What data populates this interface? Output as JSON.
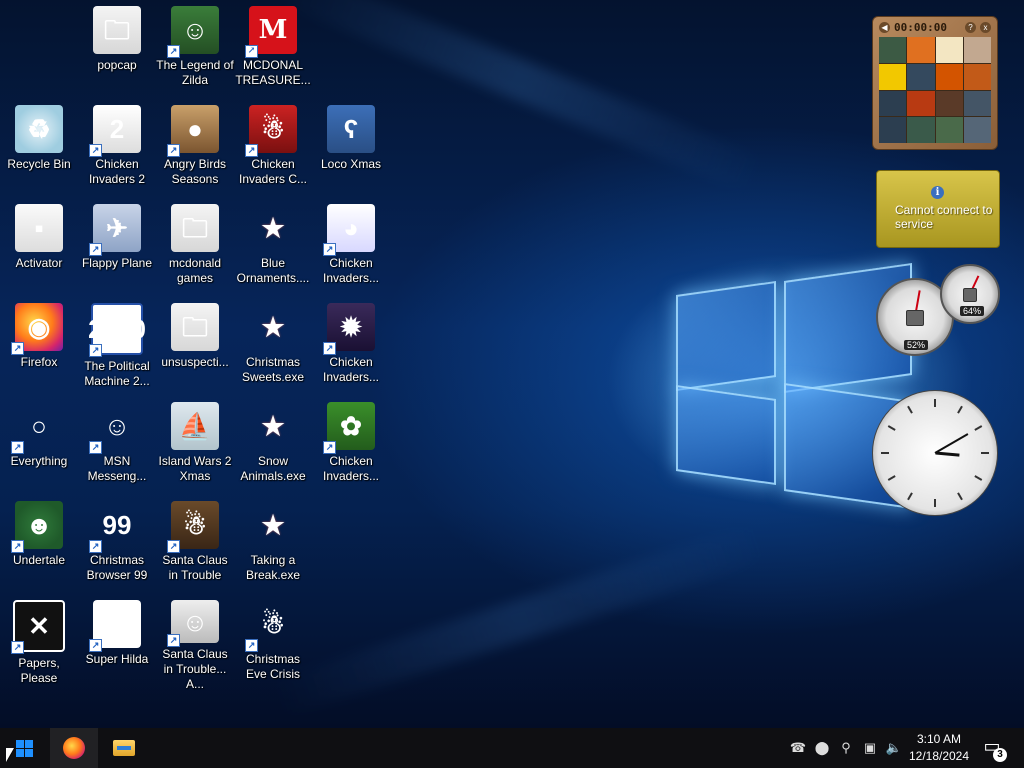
{
  "desktop_icons": [
    {
      "id": "popcap",
      "label": "popcap",
      "glyph": "🗀"
    },
    {
      "id": "legend-zilda",
      "label": "The Legend of Zilda",
      "glyph": "☺"
    },
    {
      "id": "mcdonalds-treasure",
      "label": "MCDONAL TREASURE...",
      "glyph": "M"
    },
    {
      "id": "recycle-bin",
      "label": "Recycle Bin",
      "glyph": "♻"
    },
    {
      "id": "chicken-invaders-2",
      "label": "Chicken Invaders 2",
      "glyph": "2"
    },
    {
      "id": "angry-birds-seasons",
      "label": "Angry Birds Seasons",
      "glyph": "●"
    },
    {
      "id": "chicken-invaders-c",
      "label": "Chicken Invaders C...",
      "glyph": "☃"
    },
    {
      "id": "loco-xmas",
      "label": "Loco Xmas",
      "glyph": "ʕ"
    },
    {
      "id": "activator",
      "label": "Activator",
      "glyph": "▪"
    },
    {
      "id": "flappy-plane",
      "label": "Flappy Plane",
      "glyph": "✈"
    },
    {
      "id": "mcdonald-games",
      "label": "mcdonald games",
      "glyph": "🗀"
    },
    {
      "id": "blue-ornaments",
      "label": "Blue Ornaments....",
      "glyph": "★"
    },
    {
      "id": "chicken-invaders-a",
      "label": "Chicken Invaders...",
      "glyph": "◕"
    },
    {
      "id": "firefox",
      "label": "Firefox",
      "glyph": "◉"
    },
    {
      "id": "political-machine",
      "label": "The Political Machine 2...",
      "glyph": "2020"
    },
    {
      "id": "unsuspecti",
      "label": "unsuspecti...",
      "glyph": "🗀"
    },
    {
      "id": "christmas-sweets",
      "label": "Christmas Sweets.exe",
      "glyph": "★"
    },
    {
      "id": "chicken-invaders-b",
      "label": "Chicken Invaders...",
      "glyph": "✹"
    },
    {
      "id": "everything",
      "label": "Everything",
      "glyph": "○"
    },
    {
      "id": "msn-messenger",
      "label": "MSN Messeng...",
      "glyph": "☺"
    },
    {
      "id": "island-wars-2",
      "label": "Island Wars 2 Xmas",
      "glyph": "⛵"
    },
    {
      "id": "snow-animals",
      "label": "Snow Animals.exe",
      "glyph": "★"
    },
    {
      "id": "chicken-invaders-d",
      "label": "Chicken Invaders...",
      "glyph": "✿"
    },
    {
      "id": "undertale",
      "label": "Undertale",
      "glyph": "☻"
    },
    {
      "id": "christmas-browser-99",
      "label": "Christmas Browser 99",
      "glyph": "99"
    },
    {
      "id": "santa-claus-trouble",
      "label": "Santa Claus in Trouble",
      "glyph": "☃"
    },
    {
      "id": "taking-a-break",
      "label": "Taking a Break.exe",
      "glyph": "★"
    },
    {
      "id": "papers-please",
      "label": "Papers, Please",
      "glyph": "✕"
    },
    {
      "id": "super-hilda",
      "label": "Super Hilda",
      "glyph": "▦"
    },
    {
      "id": "santa-claus-trouble-a",
      "label": "Santa Claus in Trouble... A...",
      "glyph": "☺"
    },
    {
      "id": "christmas-eve-crisis",
      "label": "Christmas Eve Crisis",
      "glyph": "☃"
    }
  ],
  "gadgets": {
    "puzzle": {
      "timer": "00:00:00",
      "help": "?",
      "close": "x",
      "tile_colors": [
        "#3c5a44",
        "#e07020",
        "#f3e6c2",
        "#c2a890",
        "#f2c800",
        "#34495e",
        "#d35400",
        "#c25a18",
        "#2c3e50",
        "#b83a12",
        "#5a3a28",
        "#445566",
        "#2c3e50",
        "#3a5a4a",
        "#4a6a4a",
        "#556677"
      ]
    },
    "service": {
      "message": "Cannot connect to service",
      "info_glyph": "i"
    },
    "cpu_meter": {
      "cpu_percent": "52%",
      "mem_percent": "64%"
    },
    "clock": {
      "hour": 3,
      "minute": 10
    }
  },
  "taskbar": {
    "start_label": "Start",
    "pinned": [
      {
        "name": "firefox"
      },
      {
        "name": "file-explorer"
      }
    ],
    "tray_glyphs": [
      "☎",
      "⬤",
      "⚲",
      "▣",
      "🔈"
    ],
    "time": "3:10 AM",
    "date": "12/18/2024",
    "notifications": "3"
  }
}
